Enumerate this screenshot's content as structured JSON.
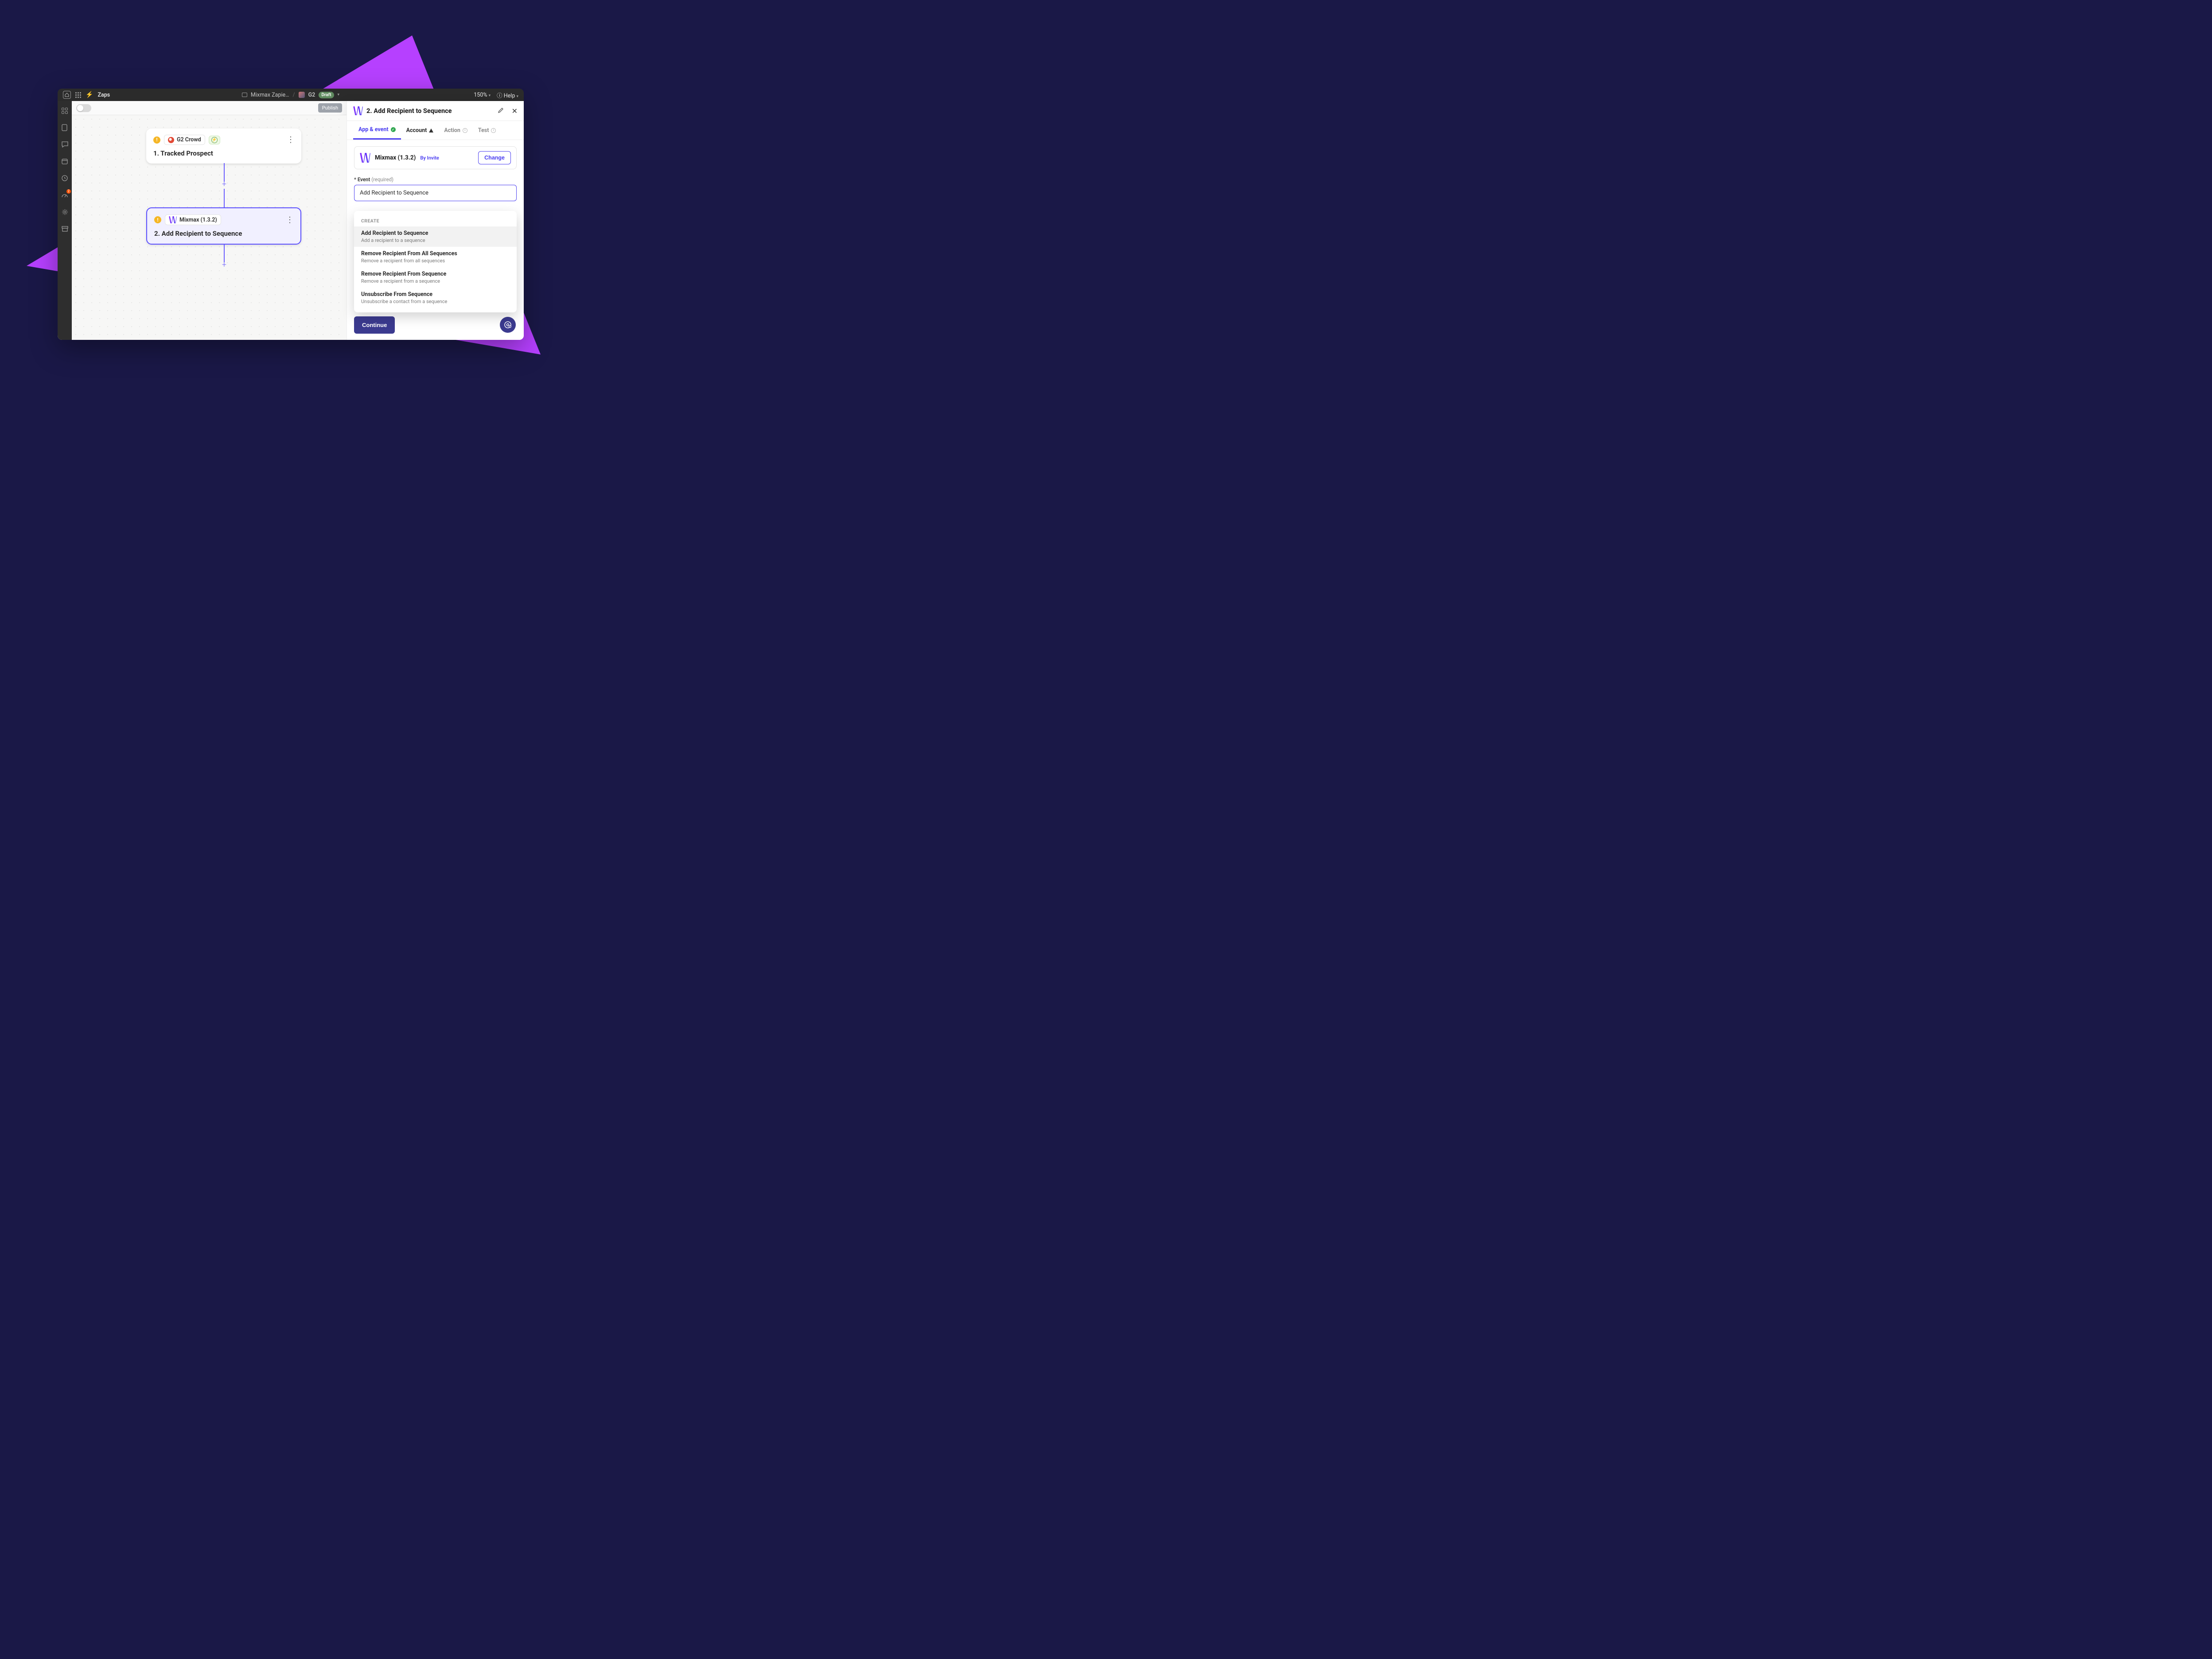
{
  "topbar": {
    "section": "Zaps",
    "folder": "Mixmax Zapie…",
    "zap_name": "G2",
    "status_pill": "Draft",
    "zoom": "150%",
    "help": "Help"
  },
  "toolbar": {
    "publish": "Publish"
  },
  "sidebar_badge": "2",
  "nodes": {
    "n1": {
      "app_chip": "G2 Crowd",
      "title": "1. Tracked Prospect"
    },
    "n2": {
      "app_chip": "Mixmax (1.3.2)",
      "title": "2. Add Recipient to Sequence"
    }
  },
  "panel": {
    "title": "2. Add Recipient to Sequence",
    "tabs": {
      "app": "App & event",
      "account": "Account",
      "action": "Action",
      "test": "Test"
    },
    "app_name": "Mixmax (1.3.2)",
    "by_invite": "By Invite",
    "change": "Change",
    "event_label_star": "*",
    "event_label": "Event",
    "event_required": "(required)",
    "event_value": "Add Recipient to Sequence",
    "continue": "Continue"
  },
  "dropdown": {
    "group": "CREATE",
    "items": [
      {
        "t": "Add Recipient to Sequence",
        "d": "Add a recipient to a sequence"
      },
      {
        "t": "Remove Recipient From All Sequences",
        "d": "Remove a recipient from all sequences"
      },
      {
        "t": "Remove Recipient From Sequence",
        "d": "Remove a recipient from a sequence"
      },
      {
        "t": "Unsubscribe From Sequence",
        "d": "Unsubscribe a contact from a sequence"
      }
    ]
  }
}
